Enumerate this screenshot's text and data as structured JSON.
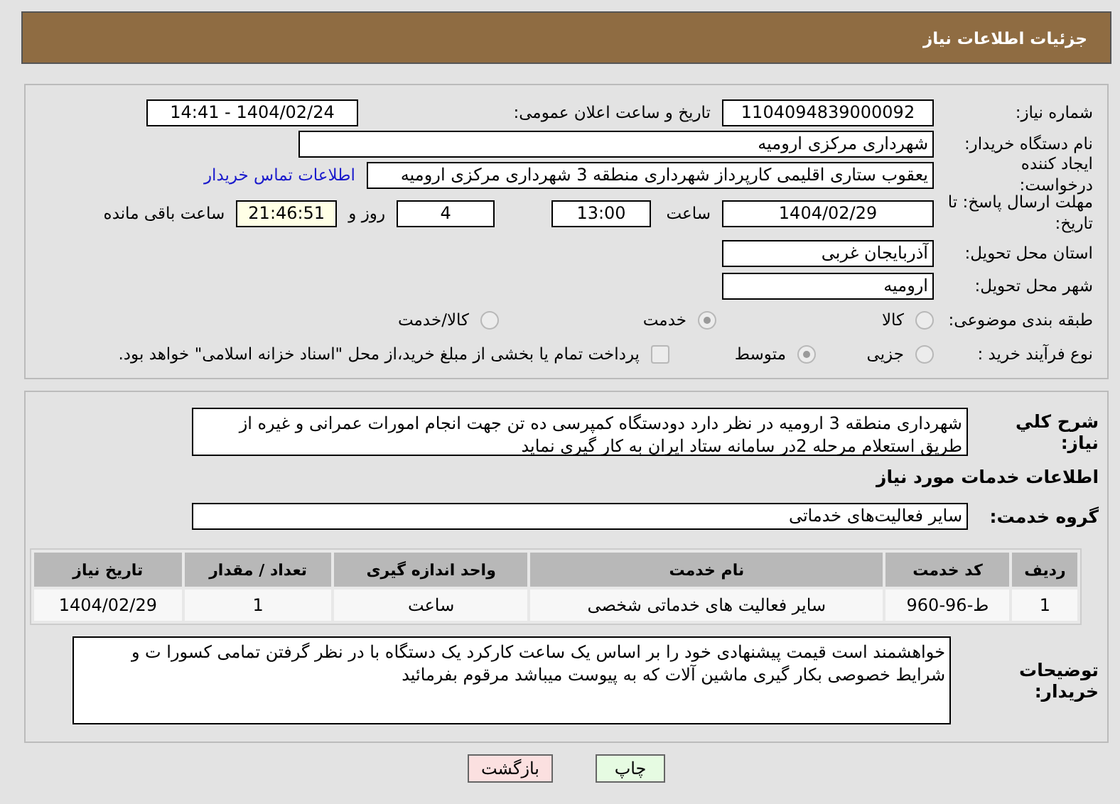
{
  "header": {
    "title": "جزئیات اطلاعات نیاز"
  },
  "need_number": {
    "label": "شماره نیاز:",
    "value": "1104094839000092"
  },
  "announce_datetime": {
    "label": "تاریخ و ساعت اعلان عمومی:",
    "value": "1404/02/24 - 14:41"
  },
  "buyer_org": {
    "label": "نام دستگاه خریدار:",
    "value": "شهرداری مرکزی ارومیه"
  },
  "requester": {
    "label": "ایجاد کننده درخواست:",
    "value": "یعقوب ستاری اقلیمی کارپرداز شهرداری منطقه 3 شهرداری مرکزی ارومیه",
    "link": "اطلاعات تماس خریدار"
  },
  "deadline": {
    "label": "مهلت ارسال پاسخ: تا تاریخ:",
    "date": "1404/02/29",
    "time_label": "ساعت",
    "time": "13:00",
    "days": "4",
    "days_label": "روز و",
    "remaining": "21:46:51",
    "remaining_label": "ساعت باقی مانده"
  },
  "province": {
    "label": "استان محل تحویل:",
    "value": "آذربایجان غربی"
  },
  "city": {
    "label": "شهر محل تحویل:",
    "value": "ارومیه"
  },
  "category": {
    "label": "طبقه بندی موضوعی:",
    "options": [
      {
        "label": "کالا",
        "selected": false
      },
      {
        "label": "خدمت",
        "selected": true
      },
      {
        "label": "کالا/خدمت",
        "selected": false
      }
    ]
  },
  "purchase_type": {
    "label": "نوع فرآیند خرید :",
    "options": [
      {
        "label": "جزیی",
        "selected": false
      },
      {
        "label": "متوسط",
        "selected": true
      }
    ],
    "payment": {
      "label": "پرداخت تمام یا بخشی از مبلغ خرید،از محل \"اسناد خزانه اسلامی\" خواهد بود.",
      "checked": false
    }
  },
  "description": {
    "label": "شرح کلي نیاز:",
    "value": "شهرداری منطقه 3 ارومیه در نظر دارد دودستگاه کمپرسی ده تن جهت انجام امورات عمرانی و غیره از طریق استعلام مرحله 2در سامانه ستاد ایران به کار گیری نماید"
  },
  "services_heading": "اطلاعات خدمات مورد نیاز",
  "service_group": {
    "label": "گروه خدمت:",
    "value": "سایر فعالیت‌های خدماتی"
  },
  "table": {
    "columns": [
      "ردیف",
      "کد خدمت",
      "نام خدمت",
      "واحد اندازه گیری",
      "تعداد / مقدار",
      "تاریخ نیاز"
    ],
    "rows": [
      [
        "1",
        "ط-96-960",
        "سایر فعالیت های خدماتی شخصی",
        "ساعت",
        "1",
        "1404/02/29"
      ]
    ]
  },
  "buyer_notes": {
    "label": "توضیحات خریدار:",
    "value": "خواهشمند است قیمت پیشنهادی خود را بر اساس یک ساعت کارکرد یک دستگاه با در نظر گرفتن تمامی کسورا ت و شرایط خصوصی بکار گیری ماشین آلات که به پیوست میباشد مرقوم بفرمائید"
  },
  "buttons": [
    {
      "label": "چاپ",
      "kind": "print"
    },
    {
      "label": "بازگشت",
      "kind": "back"
    }
  ]
}
